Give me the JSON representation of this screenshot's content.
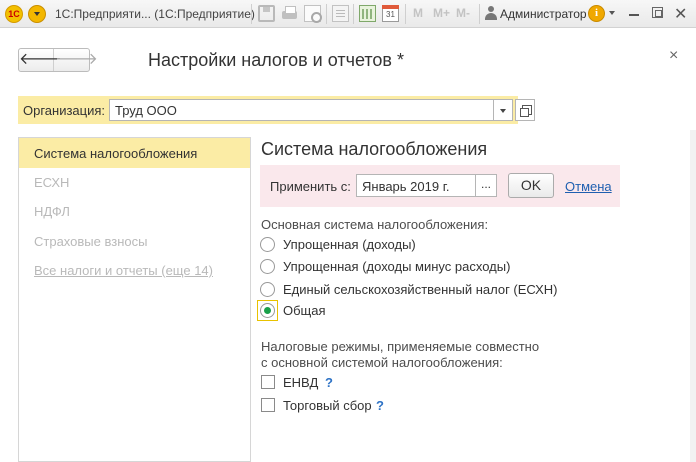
{
  "window": {
    "logo_text": "1С",
    "title": "1С:Предприяти...  (1С:Предприятие)",
    "toolbar_icons": [
      "save-icon",
      "print-icon",
      "preview-icon",
      "document-icon",
      "calculator-icon",
      "calendar-icon"
    ],
    "calendar_day": "31",
    "memory_buttons": [
      "M",
      "M+",
      "M-"
    ],
    "user_name": "Администратор",
    "info_glyph": "i"
  },
  "form": {
    "title": "Настройки налогов и отчетов *",
    "back_glyph": "🡐",
    "forward_glyph": "🡒",
    "close_glyph": "×"
  },
  "organization": {
    "label": "Организация:",
    "value": "Труд ООО"
  },
  "sidebar": {
    "items": [
      {
        "label": "Система налогообложения",
        "state": "active"
      },
      {
        "label": "ЕСХН",
        "state": "dim"
      },
      {
        "label": "НДФЛ",
        "state": "dim"
      },
      {
        "label": "Страховые взносы",
        "state": "dim"
      },
      {
        "label": "Все налоги и отчеты (еще 14)",
        "state": "link"
      }
    ]
  },
  "main": {
    "section_title": "Система налогообложения",
    "apply": {
      "label": "Применить с:",
      "value": "Январь 2019 г.",
      "dots": "...",
      "ok_label": "OK",
      "cancel_label": "Отмена"
    },
    "tax_system": {
      "label": "Основная система налогообложения:",
      "options": [
        {
          "label": "Упрощенная (доходы)",
          "selected": false
        },
        {
          "label": "Упрощенная (доходы минус расходы)",
          "selected": false
        },
        {
          "label": "Единый сельскохозяйственный налог (ЕСХН)",
          "selected": false
        },
        {
          "label": "Общая",
          "selected": true
        }
      ]
    },
    "special_regimes": {
      "label_line1": "Налоговые режимы, применяемые совместно",
      "label_line2": "с основной системой налогообложения:",
      "items": [
        {
          "label": "ЕНВД",
          "checked": false,
          "help": "?"
        },
        {
          "label": "Торговый сбор",
          "checked": false,
          "help": "?"
        }
      ]
    }
  },
  "colors": {
    "accent_yellow": "#fbeca5",
    "apply_bar": "#fae8ec",
    "link_blue": "#1f5fb0",
    "radio_selected": "#1aa04a"
  }
}
